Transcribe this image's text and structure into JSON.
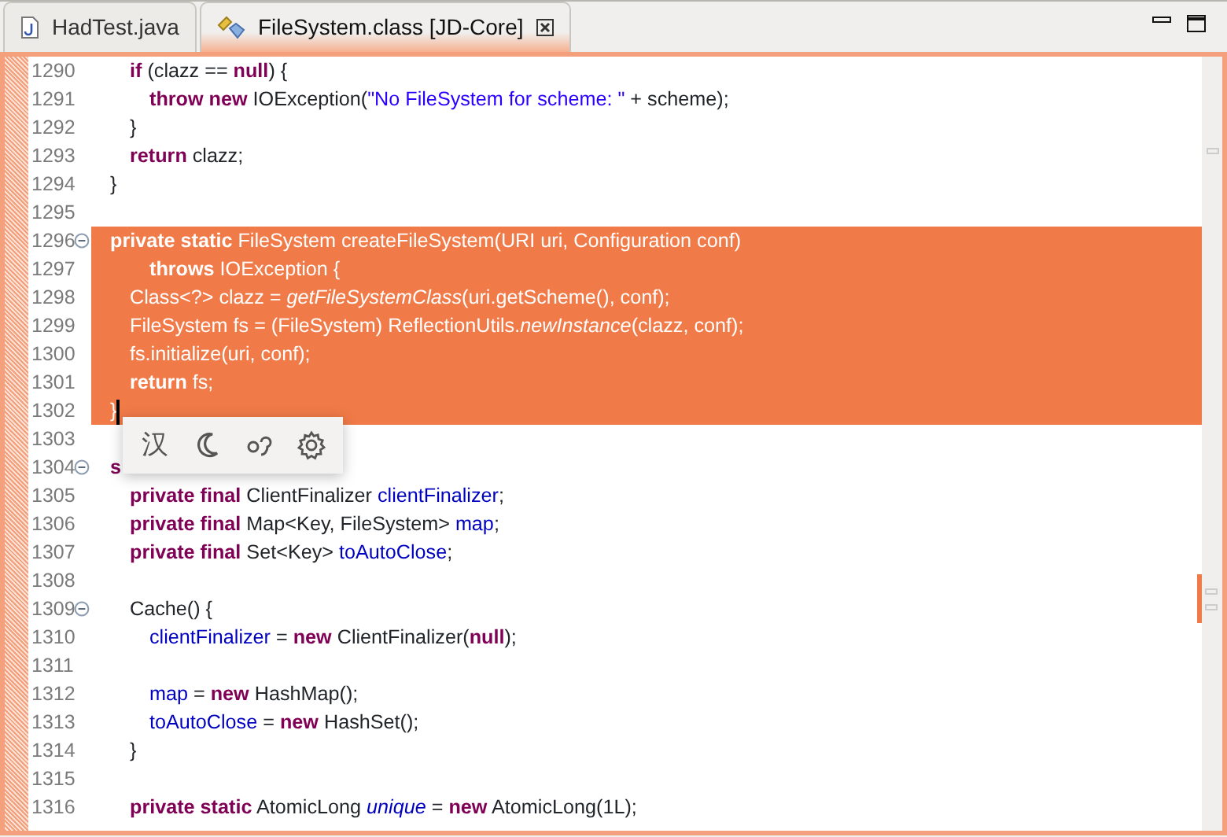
{
  "tabs": [
    {
      "label": "HadTest.java",
      "kind": "java",
      "selected": false,
      "closable": false
    },
    {
      "label": "FileSystem.class [JD-Core]",
      "kind": "class",
      "selected": true,
      "closable": true
    }
  ],
  "editor": {
    "lines": [
      {
        "number": "1290",
        "segments": [
          {
            "kind": "keyword",
            "text": "\tif"
          },
          {
            "kind": "plain",
            "text": " (clazz == "
          },
          {
            "kind": "keyword",
            "text": "null"
          },
          {
            "kind": "plain",
            "text": ") {"
          }
        ]
      },
      {
        "number": "1291",
        "segments": [
          {
            "kind": "keyword",
            "text": "\t\tthrow new"
          },
          {
            "kind": "plain",
            "text": " IOException("
          },
          {
            "kind": "string",
            "text": "\"No FileSystem for scheme: \""
          },
          {
            "kind": "plain",
            "text": " + scheme);"
          }
        ]
      },
      {
        "number": "1292",
        "segments": [
          {
            "kind": "plain",
            "text": "\t}"
          }
        ]
      },
      {
        "number": "1293",
        "segments": [
          {
            "kind": "keyword",
            "text": "\treturn"
          },
          {
            "kind": "plain",
            "text": " clazz;"
          }
        ]
      },
      {
        "number": "1294",
        "segments": [
          {
            "kind": "plain",
            "text": "}"
          }
        ]
      },
      {
        "number": "1295"
      },
      {
        "number": "1296",
        "fold": true,
        "selected": true,
        "segments": [
          {
            "kind": "keyword",
            "text": "private static"
          },
          {
            "kind": "plain",
            "text": " FileSystem createFileSystem(URI uri, Configuration conf)"
          }
        ]
      },
      {
        "number": "1297",
        "selected": true,
        "segments": [
          {
            "kind": "keyword",
            "text": "\t\tthrows"
          },
          {
            "kind": "plain",
            "text": " IOException {"
          }
        ]
      },
      {
        "number": "1298",
        "selected": true,
        "segments": [
          {
            "kind": "plain",
            "text": "\tClass<?> clazz = "
          },
          {
            "kind": "static-method",
            "text": "getFileSystemClass"
          },
          {
            "kind": "plain",
            "text": "(uri.getScheme(), conf);"
          }
        ]
      },
      {
        "number": "1299",
        "selected": true,
        "segments": [
          {
            "kind": "plain",
            "text": "\tFileSystem fs = (FileSystem) ReflectionUtils."
          },
          {
            "kind": "static-method",
            "text": "newInstance"
          },
          {
            "kind": "plain",
            "text": "(clazz, conf);"
          }
        ]
      },
      {
        "number": "1300",
        "selected": true,
        "segments": [
          {
            "kind": "plain",
            "text": "\tfs.initialize(uri, conf);"
          }
        ]
      },
      {
        "number": "1301",
        "selected": true,
        "segments": [
          {
            "kind": "keyword",
            "text": "\treturn"
          },
          {
            "kind": "plain",
            "text": " fs;"
          }
        ]
      },
      {
        "number": "1302",
        "selected": true,
        "caret": true,
        "segments": [
          {
            "kind": "plain",
            "text": "}"
          }
        ]
      },
      {
        "number": "1303"
      },
      {
        "number": "1304",
        "fold": true,
        "segments": [
          {
            "kind": "keyword",
            "text": "s"
          }
        ]
      },
      {
        "number": "1305",
        "segments": [
          {
            "kind": "keyword",
            "text": "\tprivate final"
          },
          {
            "kind": "plain",
            "text": " ClientFinalizer "
          },
          {
            "kind": "field",
            "text": "clientFinalizer"
          },
          {
            "kind": "plain",
            "text": ";"
          }
        ]
      },
      {
        "number": "1306",
        "segments": [
          {
            "kind": "keyword",
            "text": "\tprivate final"
          },
          {
            "kind": "plain",
            "text": " Map<Key, FileSystem> "
          },
          {
            "kind": "field",
            "text": "map"
          },
          {
            "kind": "plain",
            "text": ";"
          }
        ]
      },
      {
        "number": "1307",
        "segments": [
          {
            "kind": "keyword",
            "text": "\tprivate final"
          },
          {
            "kind": "plain",
            "text": " Set<Key> "
          },
          {
            "kind": "field",
            "text": "toAutoClose"
          },
          {
            "kind": "plain",
            "text": ";"
          }
        ]
      },
      {
        "number": "1308"
      },
      {
        "number": "1309",
        "fold": true,
        "segments": [
          {
            "kind": "plain",
            "text": "\tCache() {"
          }
        ]
      },
      {
        "number": "1310",
        "segments": [
          {
            "kind": "field",
            "text": "\t\tclientFinalizer"
          },
          {
            "kind": "plain",
            "text": " = "
          },
          {
            "kind": "keyword",
            "text": "new"
          },
          {
            "kind": "plain",
            "text": " ClientFinalizer("
          },
          {
            "kind": "keyword",
            "text": "null"
          },
          {
            "kind": "plain",
            "text": ");"
          }
        ]
      },
      {
        "number": "1311"
      },
      {
        "number": "1312",
        "segments": [
          {
            "kind": "field",
            "text": "\t\tmap"
          },
          {
            "kind": "plain",
            "text": " = "
          },
          {
            "kind": "keyword",
            "text": "new"
          },
          {
            "kind": "plain",
            "text": " HashMap();"
          }
        ]
      },
      {
        "number": "1313",
        "segments": [
          {
            "kind": "field",
            "text": "\t\ttoAutoClose"
          },
          {
            "kind": "plain",
            "text": " = "
          },
          {
            "kind": "keyword",
            "text": "new"
          },
          {
            "kind": "plain",
            "text": " HashSet();"
          }
        ]
      },
      {
        "number": "1314",
        "segments": [
          {
            "kind": "plain",
            "text": "\t}"
          }
        ]
      },
      {
        "number": "1315"
      },
      {
        "number": "1316",
        "segments": [
          {
            "kind": "keyword",
            "text": "\tprivate static"
          },
          {
            "kind": "plain",
            "text": " AtomicLong "
          },
          {
            "kind": "static-field",
            "text": "unique"
          },
          {
            "kind": "plain",
            "text": " = "
          },
          {
            "kind": "keyword",
            "text": "new"
          },
          {
            "kind": "plain",
            "text": " AtomicLong(1L);"
          }
        ]
      }
    ]
  },
  "popup": {
    "items": [
      {
        "kind": "text",
        "label": "汉"
      },
      {
        "kind": "moon"
      },
      {
        "kind": "swirl"
      },
      {
        "kind": "gear"
      }
    ]
  }
}
